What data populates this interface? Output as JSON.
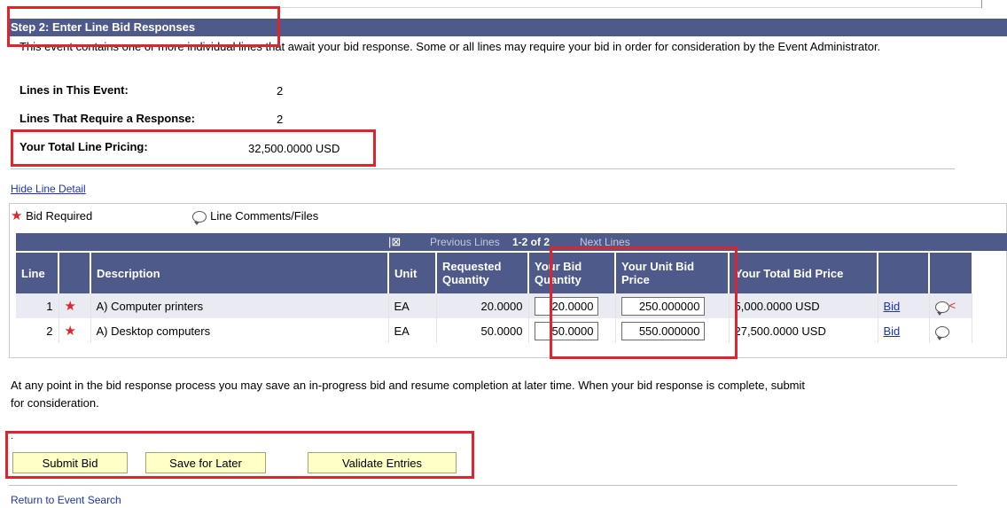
{
  "step": {
    "title": "Step 2: Enter Line Bid Responses"
  },
  "intro_text": "This event contains one or more individual lines that await your bid response. Some or all lines may require your bid in order for consideration by the Event Administrator.",
  "summary": {
    "lines_label": "Lines in This Event:",
    "lines_value": "2",
    "require_label": "Lines That Require a Response:",
    "require_value": "2",
    "pricing_label": "Your Total Line Pricing:",
    "pricing_value": "32,500.0000 USD"
  },
  "hide_link": "Hide Line Detail",
  "legend": {
    "required": "Bid Required",
    "comments": "Line Comments/Files"
  },
  "nav": {
    "previous": "Previous Lines",
    "range": "1-2 of 2",
    "next": "Next Lines"
  },
  "columns": {
    "line": "Line",
    "description": "Description",
    "unit": "Unit",
    "req_qty": "Requested Quantity",
    "bid_qty": "Your Bid Quantity",
    "unit_price": "Your Unit Bid Price",
    "total": "Your Total Bid Price"
  },
  "rows": [
    {
      "line": "1",
      "description": "A) Computer printers",
      "unit": "EA",
      "req_qty": "20.0000",
      "bid_qty": "20.0000",
      "unit_price": "250.000000",
      "total": "5,000.0000 USD",
      "bid_link": "Bid"
    },
    {
      "line": "2",
      "description": "A) Desktop computers",
      "unit": "EA",
      "req_qty": "50.0000",
      "bid_qty": "50.0000",
      "unit_price": "550.000000",
      "total": "27,500.0000 USD",
      "bid_link": "Bid"
    }
  ],
  "footer_text": "At any point in the bid response process you may save an in-progress bid and resume completion at later time. When your bid response is complete, submit for consideration.",
  "buttons": {
    "submit": "Submit Bid",
    "save": "Save for Later",
    "validate": "Validate Entries"
  },
  "return_link": "Return to Event Search",
  "colors": {
    "header_bg": "#4e5b8a",
    "button_bg": "#ffffc8",
    "highlight": "#e0242b",
    "link": "#1c34b0"
  },
  "icons": {
    "required": "star-icon",
    "comments": "comment-bubble-icon",
    "view": "view-all-icon"
  }
}
